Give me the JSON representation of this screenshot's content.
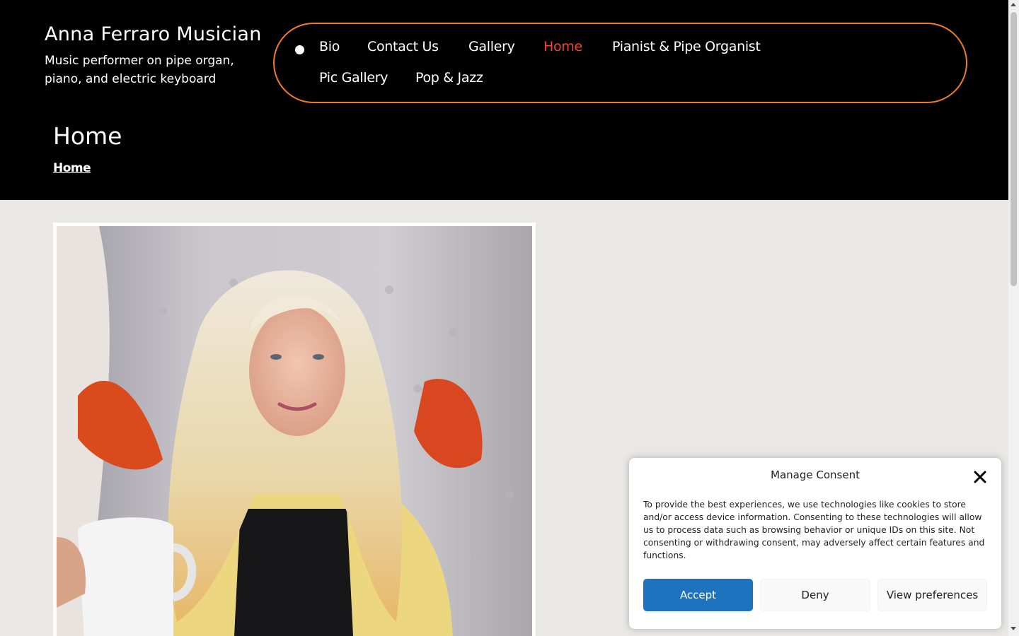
{
  "site": {
    "title": "Anna Ferraro Musician",
    "tagline": "Music performer on pipe organ, piano, and electric keyboard"
  },
  "nav": {
    "items": [
      {
        "label": "Bio"
      },
      {
        "label": "Contact Us"
      },
      {
        "label": "Gallery"
      },
      {
        "label": "Home",
        "active": true
      },
      {
        "label": "Pianist & Pipe Organist"
      },
      {
        "label": "Pic Gallery"
      },
      {
        "label": "Pop & Jazz"
      }
    ]
  },
  "page": {
    "title": "Home",
    "breadcrumb": "Home"
  },
  "consent": {
    "title": "Manage Consent",
    "body": "To provide the best experiences, we use technologies like cookies to store and/or access device information. Consenting to these technologies will allow us to process data such as browsing behavior or unique IDs on this site. Not consenting or withdrawing consent, may adversely affect certain features and functions.",
    "accept": "Accept",
    "deny": "Deny",
    "preferences": "View preferences"
  },
  "colors": {
    "header_bg": "#000000",
    "accent_orange": "#f07c22",
    "active_nav": "#ef4430",
    "page_bg": "#e9e8e5",
    "accept_blue": "#1e73be"
  },
  "icons": {
    "close": "close-icon",
    "nav_bullet": "bullet-icon"
  }
}
